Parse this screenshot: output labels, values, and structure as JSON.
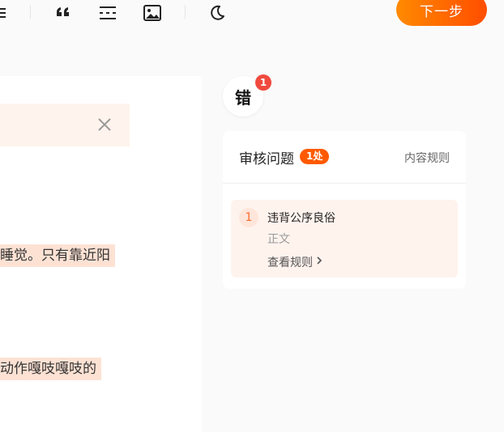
{
  "toolbar": {
    "icons": [
      "list-icon",
      "quote-icon",
      "divider-icon",
      "image-icon",
      "moon-icon"
    ],
    "next_label": "下一步"
  },
  "editor": {
    "line1": "睡觉。只有靠近阳",
    "line2": "动作嘎吱嘎吱的"
  },
  "sidebar": {
    "error_label": "错",
    "error_count": "1",
    "review": {
      "title": "审核问题",
      "count_badge": "1处",
      "rules_link": "内容规则",
      "issues": [
        {
          "index": "1",
          "title": "违背公序良俗",
          "location": "正文",
          "link": "查看规则"
        }
      ]
    }
  },
  "colors": {
    "accent": "#ff5a00",
    "highlight": "#fde2d4",
    "error_dot": "#f04a3e"
  }
}
